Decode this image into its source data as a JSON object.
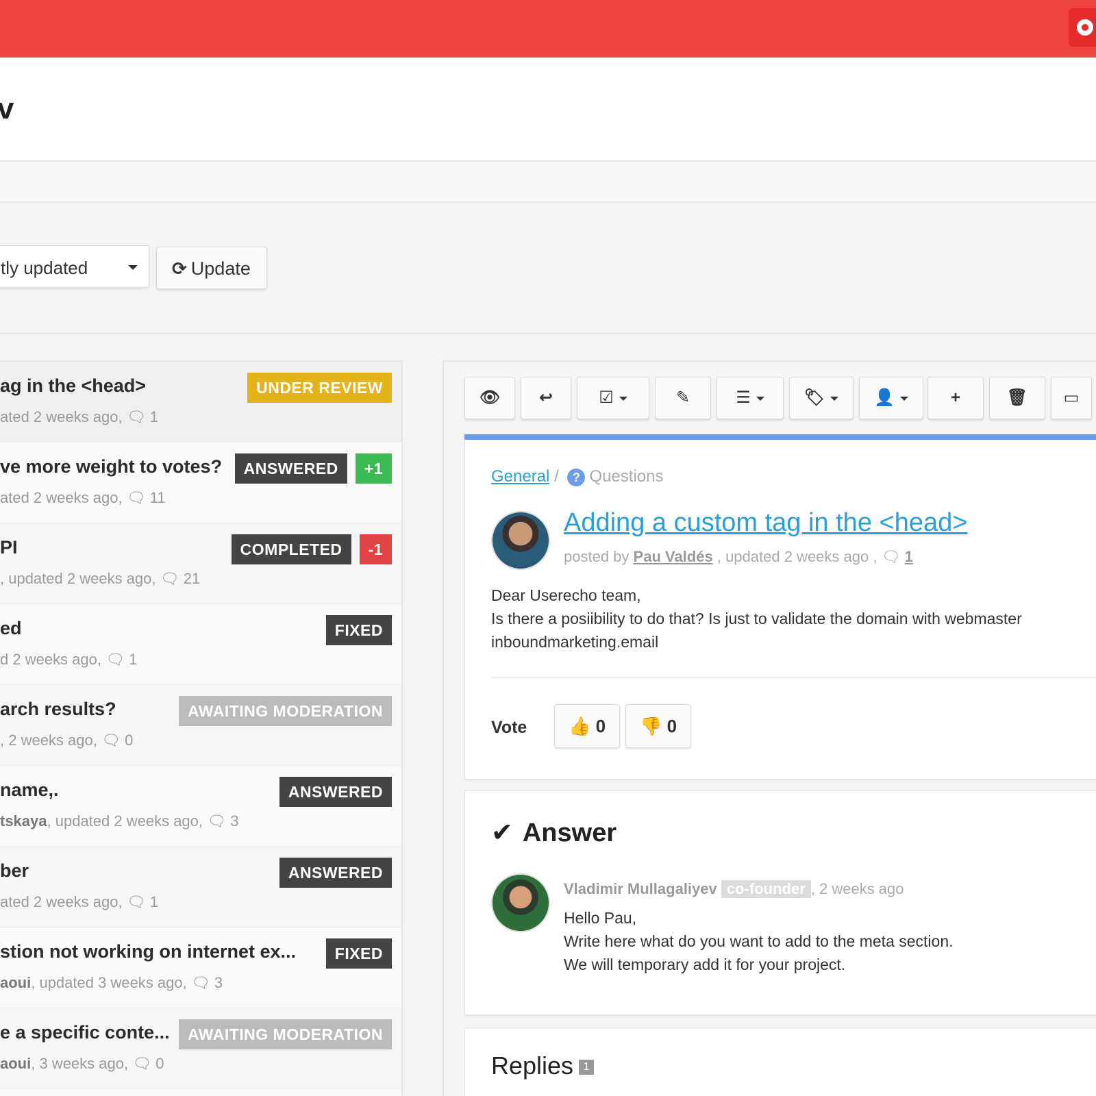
{
  "header": {
    "title_fragment": "v"
  },
  "filters": {
    "sort_value": "tly updated",
    "update_label": "Update",
    "update_icon": "⟳"
  },
  "list": [
    {
      "title": "ag in the <head>",
      "meta_author": "",
      "meta": "ated 2 weeks ago,",
      "comments": "1",
      "badges": [
        {
          "text": "UNDER REVIEW",
          "kind": "review"
        }
      ]
    },
    {
      "title": "ve more weight to votes?",
      "meta_author": "",
      "meta": "ated 2 weeks ago,",
      "comments": "11",
      "badges": [
        {
          "text": "ANSWERED",
          "kind": "dark"
        },
        {
          "text": "+1",
          "kind": "green"
        }
      ]
    },
    {
      "title": "PI",
      "meta_author": "",
      "meta": ", updated 2 weeks ago,",
      "comments": "21",
      "badges": [
        {
          "text": "COMPLETED",
          "kind": "dark"
        },
        {
          "text": "-1",
          "kind": "red"
        }
      ]
    },
    {
      "title": "ed",
      "meta_author": "",
      "meta": "d 2 weeks ago,",
      "comments": "1",
      "badges": [
        {
          "text": "FIXED",
          "kind": "dark"
        }
      ]
    },
    {
      "title": "arch results?",
      "meta_author": "",
      "meta": ", 2 weeks ago,",
      "comments": "0",
      "badges": [
        {
          "text": "AWAITING MODERATION",
          "kind": "grey"
        }
      ]
    },
    {
      "title": "name,.",
      "meta_author": "tskaya",
      "meta": ", updated 2 weeks ago,",
      "comments": "3",
      "badges": [
        {
          "text": "ANSWERED",
          "kind": "dark"
        }
      ]
    },
    {
      "title": "ber",
      "meta_author": "",
      "meta": "ated 2 weeks ago,",
      "comments": "1",
      "badges": [
        {
          "text": "ANSWERED",
          "kind": "dark"
        }
      ]
    },
    {
      "title": "stion not working on internet ex...",
      "meta_author": "aoui",
      "meta": ", updated 3 weeks ago,",
      "comments": "3",
      "badges": [
        {
          "text": "FIXED",
          "kind": "dark"
        }
      ]
    },
    {
      "title": "e a specific conte...",
      "meta_author": "aoui",
      "meta": ", 3 weeks ago,",
      "comments": "0",
      "badges": [
        {
          "text": "AWAITING MODERATION",
          "kind": "grey"
        }
      ]
    }
  ],
  "toolbar": {
    "buttons": [
      {
        "name": "toggle-visibility-button",
        "icon": "eye-slash-icon",
        "glyph": "👁",
        "caret": false
      },
      {
        "name": "reply-button",
        "icon": "reply-icon",
        "glyph": "↩",
        "caret": false
      },
      {
        "name": "status-button",
        "icon": "check-square-icon",
        "glyph": "☑",
        "caret": true
      },
      {
        "name": "edit-button",
        "icon": "edit-icon",
        "glyph": "✎",
        "caret": false
      },
      {
        "name": "list-button",
        "icon": "list-icon",
        "glyph": "☰",
        "caret": true
      },
      {
        "name": "tag-button",
        "icon": "tag-icon",
        "glyph": "🏷",
        "caret": true
      },
      {
        "name": "assign-user-button",
        "icon": "user-icon",
        "glyph": "👤",
        "caret": true
      },
      {
        "name": "add-button",
        "icon": "plus-icon",
        "glyph": "+",
        "caret": false
      },
      {
        "name": "delete-button",
        "icon": "trash-icon",
        "glyph": "🗑",
        "caret": false
      },
      {
        "name": "more-button",
        "icon": "window-icon",
        "glyph": "▭",
        "caret": false
      }
    ]
  },
  "post": {
    "breadcrumb_link": "General",
    "breadcrumb_sep": "/",
    "breadcrumb_current": "Questions",
    "title": "Adding a custom tag in the <head>",
    "meta_prefix": "posted by",
    "author": "Pau Valdés",
    "meta_suffix": ", updated 2 weeks ago ,",
    "comments": "1",
    "body_lines": [
      "Dear Userecho team,",
      "Is there a posiibility to do that? Is just to validate the domain with webmaster",
      "inboundmarketing.email"
    ],
    "vote_label": "Vote",
    "upvotes": "0",
    "downvotes": "0"
  },
  "answer": {
    "heading": "Answer",
    "author": "Vladimir Mullagaliyev",
    "role": "co-founder",
    "time": ", 2 weeks ago",
    "body_lines": [
      "Hello Pau,",
      "Write here what do you want to add to the meta section.",
      "We will temporary add it for your project."
    ]
  },
  "replies": {
    "heading": "Replies",
    "count": "1"
  },
  "colors": {
    "topbar": "#f04444",
    "accent_blue": "#2a9fd6",
    "review": "#e4b21a",
    "dark_badge": "#444444",
    "green": "#3cba54",
    "red": "#e04444",
    "grey_badge": "#bbbbbb"
  }
}
